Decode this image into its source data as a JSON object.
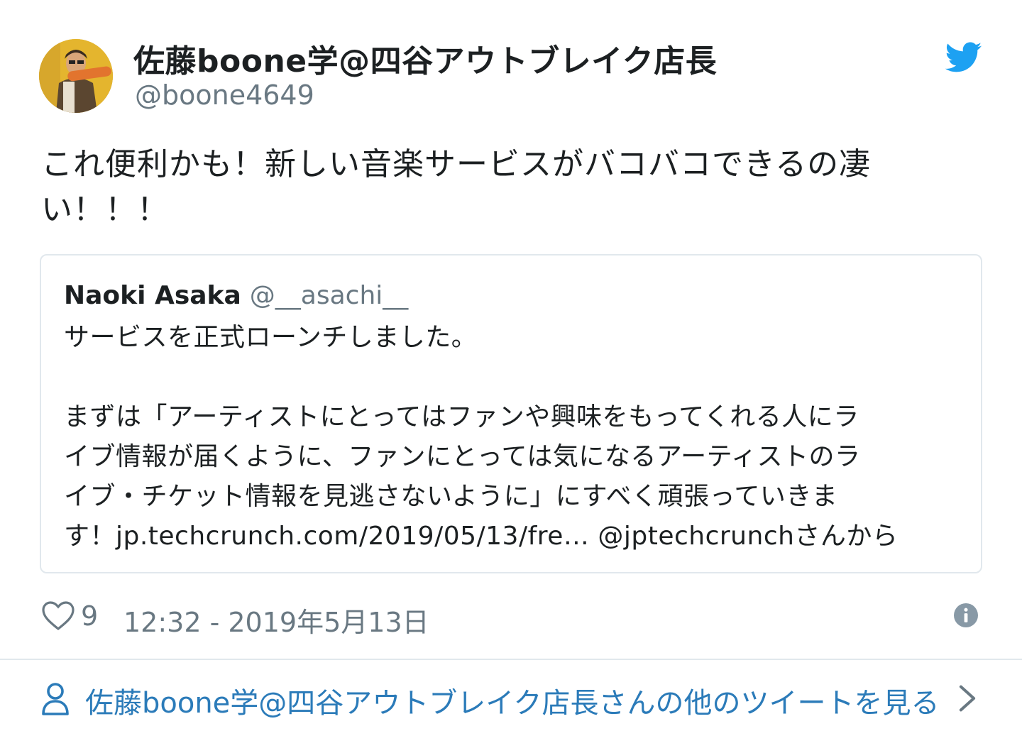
{
  "author": {
    "name": "佐藤boone学@四谷アウトブレイク店長",
    "handle": "@boone4649"
  },
  "tweet": {
    "text_lines": [
      "これ便利かも！新しい音楽サービスがバコバコできるの凄",
      "い！！！"
    ]
  },
  "quoted_tweet": {
    "name": "Naoki Asaka",
    "handle": "@__asachi__",
    "lines": [
      "サービスを正式ローンチしました。",
      "",
      "まずは「アーティストにとってはファンや興味をもってくれる人にラ",
      "イブ情報が届くように、ファンにとっては気になるアーティストのラ",
      "イブ・チケット情報を見逃さないように」にすべく頑張っていきま",
      "す！jp.techcrunch.com/2019/05/13/fre… @jptechcrunchさんから"
    ]
  },
  "meta": {
    "like_count": "9",
    "timestamp": "12:32 - 2019年5月13日"
  },
  "footer": {
    "more_link": "佐藤boone学@四谷アウトブレイク店長さんの他のツイートを見る"
  },
  "icons": {
    "brand": "twitter-bird-icon",
    "like": "heart-icon",
    "info": "info-icon",
    "profile": "person-icon",
    "next": "chevron-right-icon"
  },
  "colors": {
    "twitter_blue": "#1da1f2",
    "link_blue": "#2b7bb9",
    "muted_text": "#697882",
    "border": "#e1e8ed"
  }
}
